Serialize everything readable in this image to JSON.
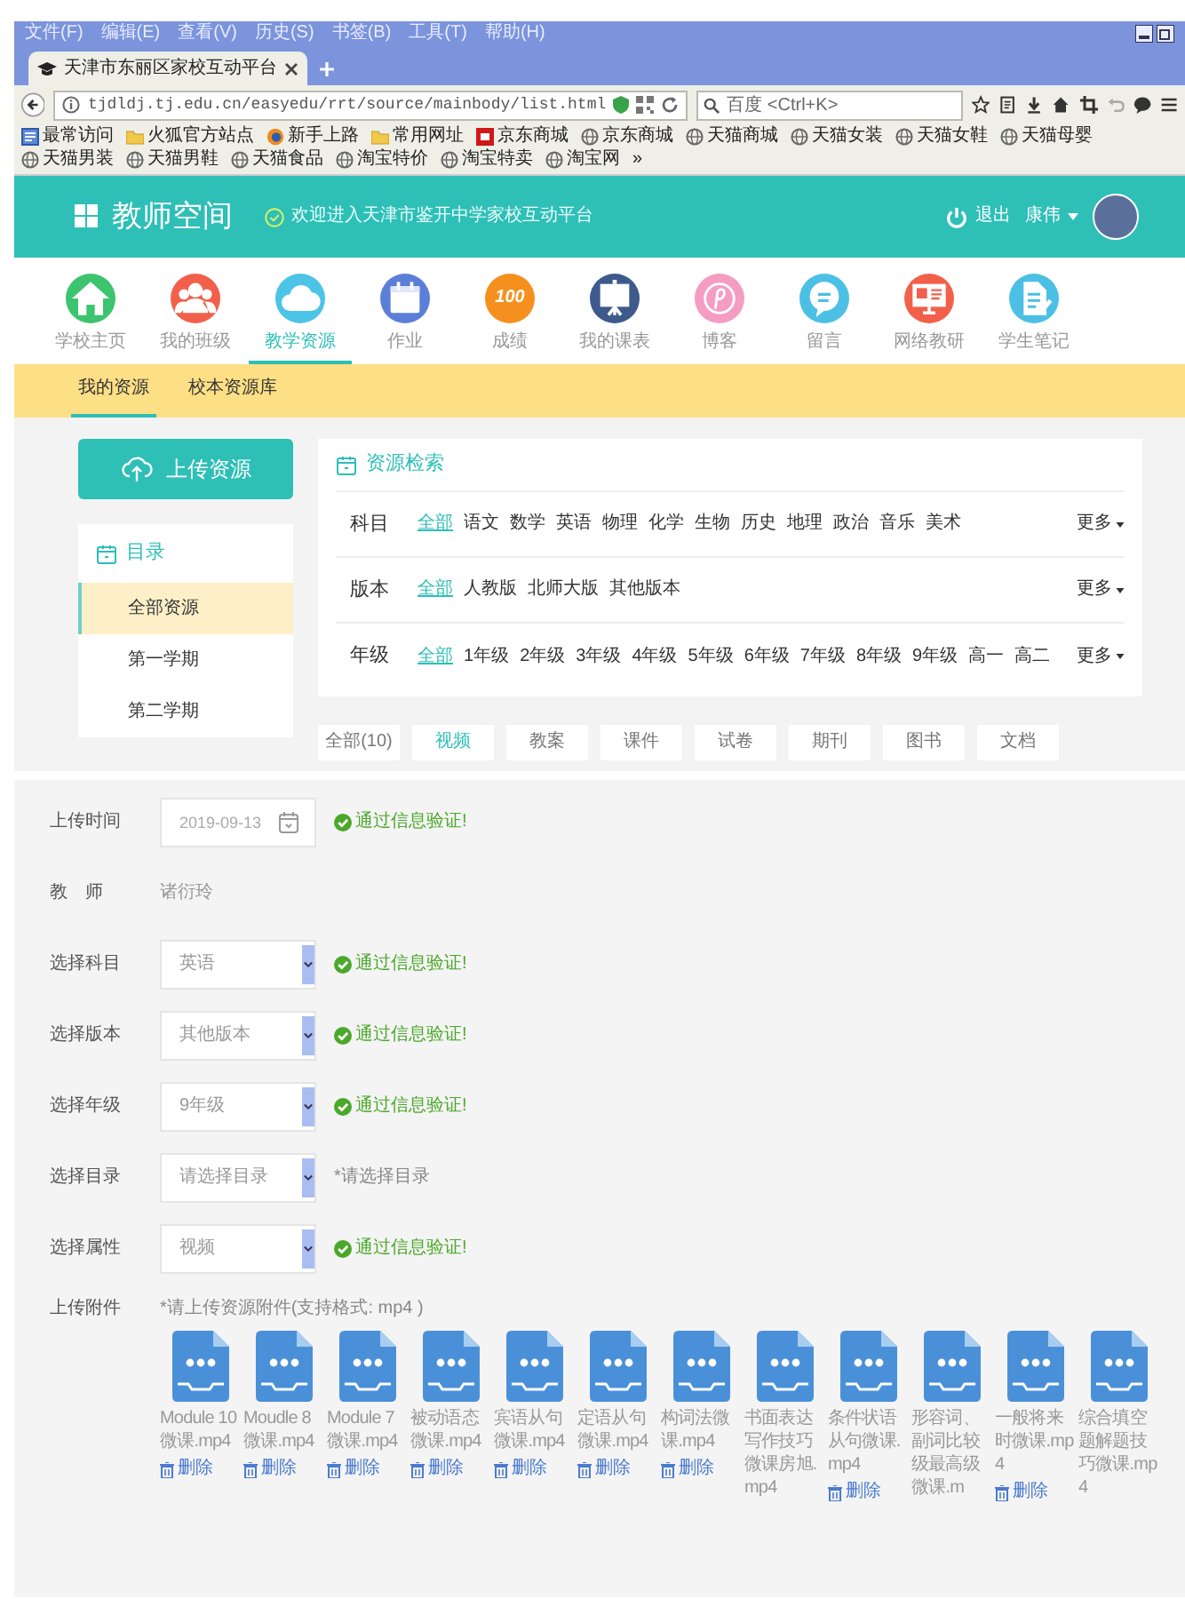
{
  "browser": {
    "menu": [
      "文件(F)",
      "编辑(E)",
      "查看(V)",
      "历史(S)",
      "书签(B)",
      "工具(T)",
      "帮助(H)"
    ],
    "tab": {
      "title": "天津市东丽区家校互动平台"
    },
    "address": "tjdldj.tj.edu.cn/easyedu/rrt/source/mainbody/list.html",
    "search_placeholder": "百度 <Ctrl+K>",
    "bookmarks": [
      {
        "label": "最常访问",
        "kind": "list"
      },
      {
        "label": "火狐官方站点",
        "kind": "folder"
      },
      {
        "label": "新手上路",
        "kind": "browser"
      },
      {
        "label": "常用网址",
        "kind": "folder"
      },
      {
        "label": "京东商城",
        "kind": "store"
      },
      {
        "label": "京东商城",
        "kind": "globe"
      },
      {
        "label": "天猫商城",
        "kind": "globe"
      },
      {
        "label": "天猫女装",
        "kind": "globe"
      },
      {
        "label": "天猫女鞋",
        "kind": "globe"
      },
      {
        "label": "天猫母婴",
        "kind": "globe"
      },
      {
        "label": "天猫男装",
        "kind": "globe"
      },
      {
        "label": "天猫男鞋",
        "kind": "globe"
      },
      {
        "label": "天猫食品",
        "kind": "globe"
      },
      {
        "label": "淘宝特价",
        "kind": "globe"
      },
      {
        "label": "淘宝特卖",
        "kind": "globe"
      },
      {
        "label": "淘宝网",
        "kind": "globe"
      }
    ],
    "bookmarks_more": "»"
  },
  "header": {
    "title": "教师空间",
    "welcome": "欢迎进入天津市鉴开中学家校互动平台",
    "logout": "退出",
    "user": "康伟"
  },
  "nav": [
    {
      "label": "学校主页",
      "kind": "house",
      "color": "#3cc46e",
      "selected": false
    },
    {
      "label": "我的班级",
      "kind": "people",
      "color": "#f2604c",
      "selected": false
    },
    {
      "label": "教学资源",
      "kind": "cloud",
      "color": "#4cc4e8",
      "selected": true
    },
    {
      "label": "作业",
      "kind": "calendar",
      "color": "#5b7fd8",
      "selected": false
    },
    {
      "label": "成绩",
      "kind": "score",
      "icon_text": "100",
      "color": "#f5901e",
      "selected": false
    },
    {
      "label": "我的课表",
      "kind": "board",
      "color": "#3e5a8c",
      "selected": false
    },
    {
      "label": "博客",
      "kind": "blog",
      "color": "#f59cc2",
      "selected": false
    },
    {
      "label": "留言",
      "kind": "chat",
      "color": "#4cc0e4",
      "selected": false
    },
    {
      "label": "网络教研",
      "kind": "screen",
      "color": "#f2604c",
      "selected": false
    },
    {
      "label": "学生笔记",
      "kind": "note",
      "color": "#4cc0e4",
      "selected": false
    }
  ],
  "subnav": [
    {
      "label": "我的资源",
      "selected": true
    },
    {
      "label": "校本资源库",
      "selected": false
    }
  ],
  "sidebar": {
    "upload_button": "上传资源",
    "title": "目录",
    "items": [
      {
        "label": "全部资源",
        "selected": true
      },
      {
        "label": "第一学期",
        "selected": false
      },
      {
        "label": "第二学期",
        "selected": false
      }
    ]
  },
  "search_panel": {
    "title": "资源检索",
    "filters": [
      {
        "label": "科目",
        "more": "更多",
        "options": [
          {
            "label": "全部",
            "selected": true
          },
          {
            "label": "语文",
            "selected": false
          },
          {
            "label": "数学",
            "selected": false
          },
          {
            "label": "英语",
            "selected": false
          },
          {
            "label": "物理",
            "selected": false
          },
          {
            "label": "化学",
            "selected": false
          },
          {
            "label": "生物",
            "selected": false
          },
          {
            "label": "历史",
            "selected": false
          },
          {
            "label": "地理",
            "selected": false
          },
          {
            "label": "政治",
            "selected": false
          },
          {
            "label": "音乐",
            "selected": false
          },
          {
            "label": "美术",
            "selected": false
          }
        ]
      },
      {
        "label": "版本",
        "more": "更多",
        "options": [
          {
            "label": "全部",
            "selected": true
          },
          {
            "label": "人教版",
            "selected": false
          },
          {
            "label": "北师大版",
            "selected": false
          },
          {
            "label": "其他版本",
            "selected": false
          }
        ]
      },
      {
        "label": "年级",
        "more": "更多",
        "options": [
          {
            "label": "全部",
            "selected": true
          },
          {
            "label": "1年级",
            "selected": false
          },
          {
            "label": "2年级",
            "selected": false
          },
          {
            "label": "3年级",
            "selected": false
          },
          {
            "label": "4年级",
            "selected": false
          },
          {
            "label": "5年级",
            "selected": false
          },
          {
            "label": "6年级",
            "selected": false
          },
          {
            "label": "7年级",
            "selected": false
          },
          {
            "label": "8年级",
            "selected": false
          },
          {
            "label": "9年级",
            "selected": false
          },
          {
            "label": "高一",
            "selected": false
          },
          {
            "label": "高二",
            "selected": false
          }
        ]
      }
    ]
  },
  "type_tabs": [
    {
      "label": "全部(10)",
      "selected": false
    },
    {
      "label": "视频",
      "selected": true
    },
    {
      "label": "教案",
      "selected": false
    },
    {
      "label": "课件",
      "selected": false
    },
    {
      "label": "试卷",
      "selected": false
    },
    {
      "label": "期刊",
      "selected": false
    },
    {
      "label": "图书",
      "selected": false
    },
    {
      "label": "文档",
      "selected": false
    }
  ],
  "form": {
    "rows": [
      {
        "label": "上传时间",
        "kind": "date",
        "value": "2019-09-13",
        "status": {
          "kind": "ok",
          "text": "通过信息验证!"
        }
      },
      {
        "label": "教　师",
        "kind": "text",
        "value": "诸衍玲"
      },
      {
        "label": "选择科目",
        "kind": "select",
        "value": "英语",
        "status": {
          "kind": "ok",
          "text": "通过信息验证!"
        }
      },
      {
        "label": "选择版本",
        "kind": "select",
        "value": "其他版本",
        "status": {
          "kind": "ok",
          "text": "通过信息验证!"
        }
      },
      {
        "label": "选择年级",
        "kind": "select",
        "value": "9年级",
        "status": {
          "kind": "ok",
          "text": "通过信息验证!"
        }
      },
      {
        "label": "选择目录",
        "kind": "select",
        "placeholder": "请选择目录",
        "status": {
          "kind": "hint",
          "text": "*请选择目录"
        }
      },
      {
        "label": "选择属性",
        "kind": "select",
        "value": "视频",
        "status": {
          "kind": "ok",
          "text": "通过信息验证!"
        }
      }
    ],
    "attachments": {
      "label": "上传附件",
      "hint": "*请上传资源附件(支持格式: mp4 )",
      "files": [
        {
          "name": "Module 10微课.mp4",
          "delete": "删除"
        },
        {
          "name": "Moudle 8微课.mp4",
          "delete": "删除"
        },
        {
          "name": "Module 7微课.mp4",
          "delete": "删除"
        },
        {
          "name": "被动语态微课.mp4",
          "delete": "删除"
        },
        {
          "name": "宾语从句微课.mp4",
          "delete": "删除"
        },
        {
          "name": "定语从句微课.mp4",
          "delete": "删除"
        },
        {
          "name": "构词法微课.mp4",
          "delete": "删除"
        },
        {
          "name": "书面表达写作技巧微课房旭.mp4"
        },
        {
          "name": "条件状语从句微课.mp4",
          "delete": "删除"
        },
        {
          "name": "形容词、副词比较级最高级微课.m"
        },
        {
          "name": "一般将来时微课.mp4",
          "delete": "删除"
        },
        {
          "name": "综合填空题解题技巧微课.mp4"
        }
      ]
    }
  }
}
